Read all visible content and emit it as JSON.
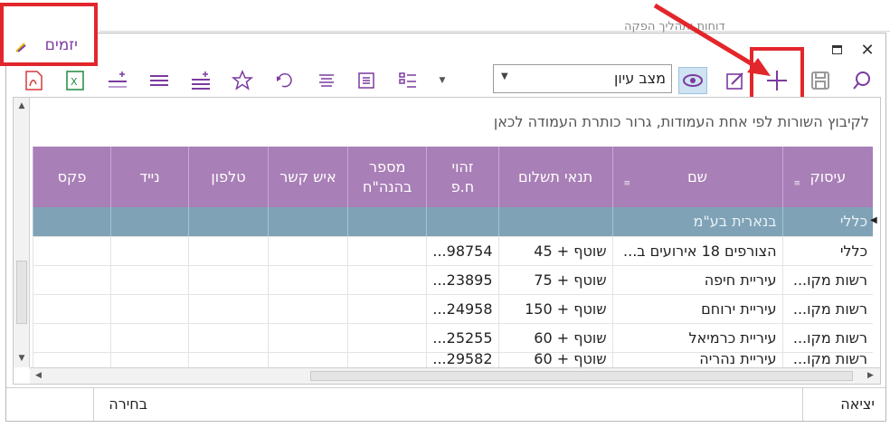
{
  "window": {
    "title": "יזמים",
    "background_heading": "דוחות ותהליך הפקה"
  },
  "toolbar": {
    "view_mode": "מצב עיון",
    "icons": [
      "search-icon",
      "save-icon",
      "add-icon",
      "edit-icon",
      "view-icon",
      "dropdown-icon",
      "checklist-icon",
      "indent-icon",
      "align-icon",
      "undo-star-icon",
      "star-icon",
      "add-row-icon",
      "lines-icon",
      "insert-line-icon",
      "excel-icon",
      "pdf-icon"
    ]
  },
  "grid": {
    "group_hint": "לקיבוץ השורות לפי אחת העמודות, גרור כותרת העמודה לכאן",
    "columns": [
      "עיסוק",
      "שם",
      "תנאי תשלום",
      "זהוי ח.פ",
      "מספר בהנה\"ח",
      "איש קשר",
      "טלפון",
      "נייד",
      "פקס"
    ],
    "group_row": {
      "occupation": "כללי",
      "name": "בנארית בע\"מ"
    },
    "rows": [
      {
        "occupation": "כללי",
        "name": "הצורפים 18 אירועים ב...",
        "payment": "שוטף + 45",
        "id": "98754..."
      },
      {
        "occupation": "רשות מקו...",
        "name": "עיריית חיפה",
        "payment": "שוטף + 75",
        "id": "23895..."
      },
      {
        "occupation": "רשות מקו...",
        "name": "עיריית ירוחם",
        "payment": "שוטף + 150",
        "id": "24958..."
      },
      {
        "occupation": "רשות מקו...",
        "name": "עיריית כרמיאל",
        "payment": "שוטף + 60",
        "id": "25255..."
      },
      {
        "occupation": "רשות מקו...",
        "name": "עיריית נהריה",
        "payment": "שוטף + 60",
        "id": "29582..."
      }
    ]
  },
  "status": {
    "exit_label": "יציאה",
    "choose_label": "בחירה"
  },
  "colors": {
    "header_bg": "#a97fb7",
    "group_row_bg": "#7fa2b7",
    "annotation_red": "#e2262b",
    "icon_purple": "#7b3aa0"
  }
}
